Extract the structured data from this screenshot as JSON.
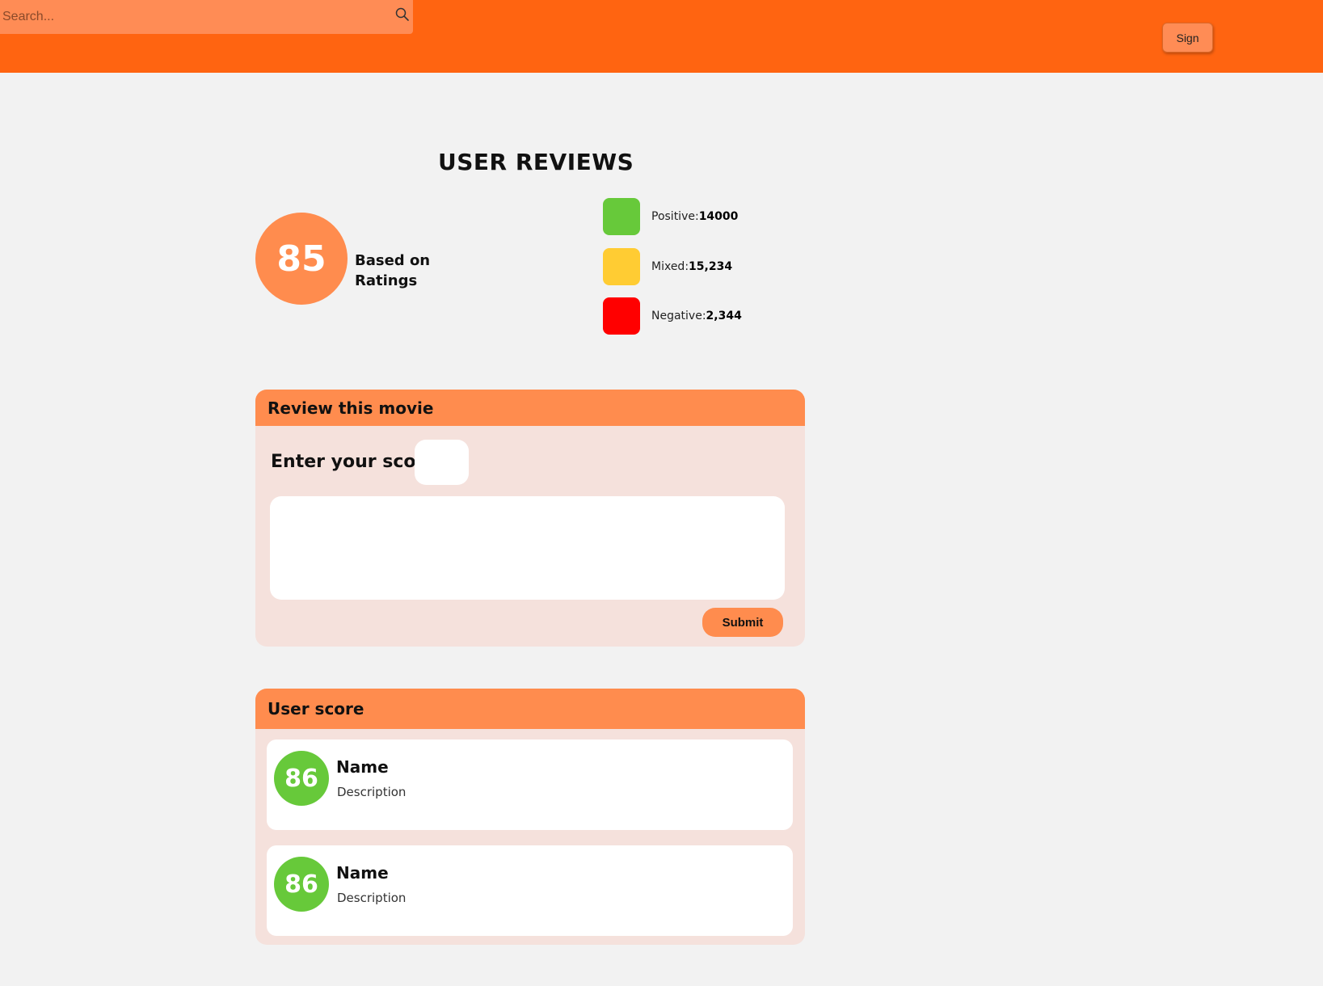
{
  "header": {
    "search_placeholder": "Search...",
    "search_icon": "search-icon",
    "sign_label": "Sign",
    "background_color": "#ff6411"
  },
  "reviews_summary": {
    "title": "USER REVIEWS",
    "score": "85",
    "based_on": "Based on Ratings",
    "score_color": "#ff8c4e",
    "legend": [
      {
        "label": "Positive:",
        "value": "14000",
        "color": "#67c93a"
      },
      {
        "label": "Mixed:",
        "value": "15,234",
        "color": "#ffcc33"
      },
      {
        "label": "Negative:",
        "value": "2,344",
        "color": "#ff0000"
      }
    ]
  },
  "review_form": {
    "header": "Review this movie",
    "score_label": "Enter your score:",
    "score_value": "",
    "review_text": "",
    "submit_label": "Submit"
  },
  "user_score": {
    "header": "User score",
    "items": [
      {
        "score": "86",
        "name": "Name",
        "description": "Description"
      },
      {
        "score": "86",
        "name": "Name",
        "description": "Description"
      }
    ]
  }
}
